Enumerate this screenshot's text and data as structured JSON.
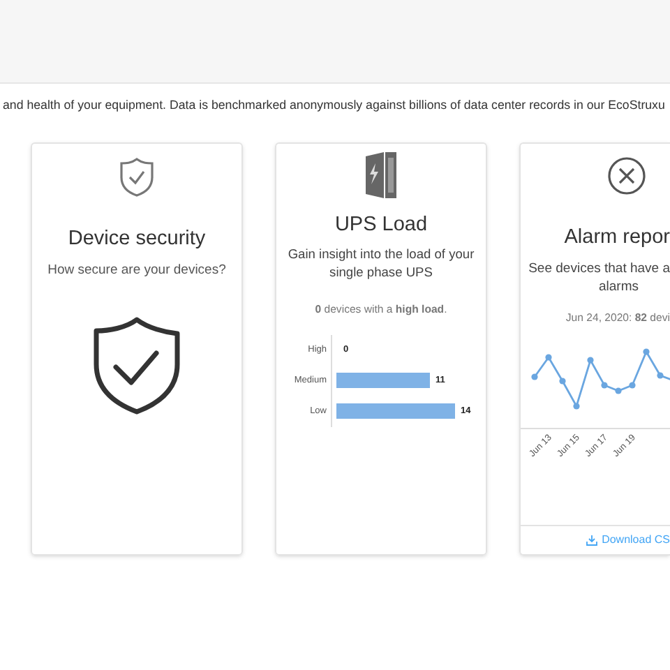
{
  "intro": "and health of your equipment. Data is benchmarked anonymously against billions of data center records in our EcoStruxu",
  "cards": [
    {
      "kind": "security",
      "title": "Device security",
      "description": "How secure are your devices?"
    },
    {
      "kind": "ups",
      "title": "UPS Load",
      "description": "Gain insight into the load of your single phase UPS",
      "summary": "**0** devices with a **high load**.",
      "chart_data": {
        "type": "bar",
        "orientation": "horizontal",
        "categories": [
          "High",
          "Medium",
          "Low"
        ],
        "values": [
          0,
          11,
          14
        ],
        "data_labels": true
      }
    },
    {
      "kind": "alarm",
      "title": "Alarm repor",
      "description_lines": [
        "See devices that have a",
        "alarms"
      ],
      "summary": "Jun 24, 2020: **82** devi",
      "x_labels": [
        "Jun 13",
        "Jun 15",
        "Jun 17",
        "Jun 19"
      ],
      "link": "Download CS"
    }
  ]
}
